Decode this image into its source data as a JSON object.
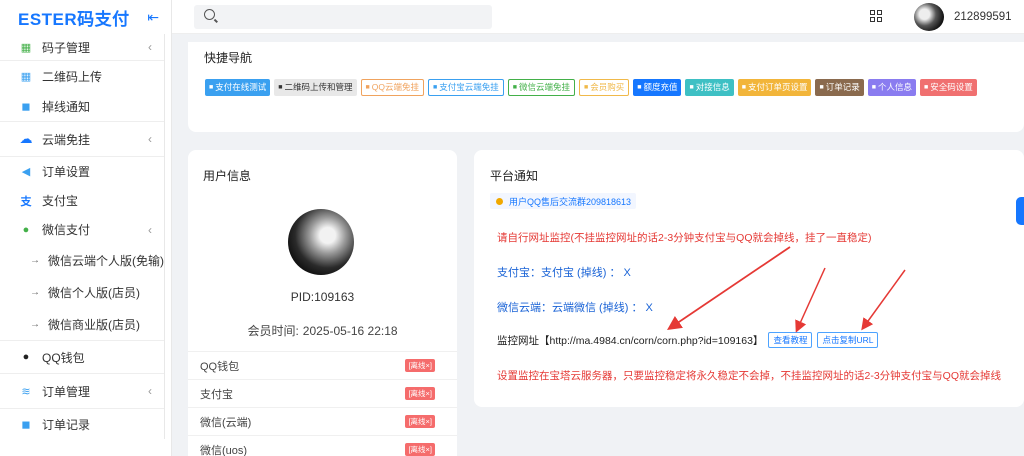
{
  "app": {
    "title": "ESTER码支付"
  },
  "header": {
    "username": "212899591",
    "search_placeholder": ""
  },
  "sidebar": {
    "items": [
      {
        "label": "码子管理"
      },
      {
        "label": "二维码上传"
      },
      {
        "label": "掉线通知"
      },
      {
        "label": "云端免挂"
      },
      {
        "label": "订单设置"
      },
      {
        "label": "支付宝"
      },
      {
        "label": "微信支付"
      },
      {
        "label": "微信云端个人版(免输)"
      },
      {
        "label": "微信个人版(店员)"
      },
      {
        "label": "微信商业版(店员)"
      },
      {
        "label": "QQ钱包"
      },
      {
        "label": "订单管理"
      },
      {
        "label": "订单记录"
      }
    ]
  },
  "quick": {
    "title": "快捷导航",
    "buttons": [
      {
        "label": "支付在线测试",
        "color": "#3aa0f0",
        "style": "fill"
      },
      {
        "label": "二维码上传和管理",
        "color": "#e8e8e8",
        "style": "grey"
      },
      {
        "label": "QQ云端免挂",
        "color": "#f0a35e",
        "style": "outline"
      },
      {
        "label": "支付宝云端免挂",
        "color": "#3aa0f0",
        "style": "outline"
      },
      {
        "label": "微信云端免挂",
        "color": "#43b049",
        "style": "outline"
      },
      {
        "label": "会员购买",
        "color": "#f0b94a",
        "style": "outline"
      },
      {
        "label": "额度充值",
        "color": "#1677ff",
        "style": "fill"
      },
      {
        "label": "对接信息",
        "color": "#3ec0c4",
        "style": "fill"
      },
      {
        "label": "支付订单页设置",
        "color": "#f2b53a",
        "style": "fill"
      },
      {
        "label": "订单记录",
        "color": "#8a6a4e",
        "style": "fill"
      },
      {
        "label": "个人信息",
        "color": "#8a7cf0",
        "style": "fill"
      },
      {
        "label": "安全码设置",
        "color": "#f07070",
        "style": "fill"
      }
    ]
  },
  "user_info": {
    "title": "用户信息",
    "pid": "PID:109163",
    "member_label": "会员时间:",
    "member_time": "2025-05-16 22:18",
    "rows": [
      {
        "label": "QQ钱包",
        "badge": "[离线×]"
      },
      {
        "label": "支付宝",
        "badge": "[离线×]"
      },
      {
        "label": "微信(云端)",
        "badge": "[离线×]"
      },
      {
        "label": "微信(uos)",
        "badge": "[离线×]"
      }
    ]
  },
  "notice": {
    "title": "平台通知",
    "qq_group": "用户QQ售后交流群209818613",
    "line1": "请自行网址监控(不挂监控网址的话2-3分钟支付宝与QQ就会掉线，挂了一直稳定)",
    "line2": "支付宝：支付宝   (掉线) ： X",
    "line3": "微信云端：云端微信   (掉线) ： X",
    "monitor_label": "监控网址【http://ma.4984.cn/corn/corn.php?id=109163】",
    "btn_tutorial": "查看教程",
    "btn_copy": "点击复制URL",
    "line5": "设置监控在宝塔云服务器，只要监控稳定将永久稳定不会掉，不挂监控网址的话2-3分钟支付宝与QQ就会掉线"
  },
  "colors": {
    "accent": "#1677ff",
    "danger": "#e53935",
    "link": "#1a63d6"
  }
}
